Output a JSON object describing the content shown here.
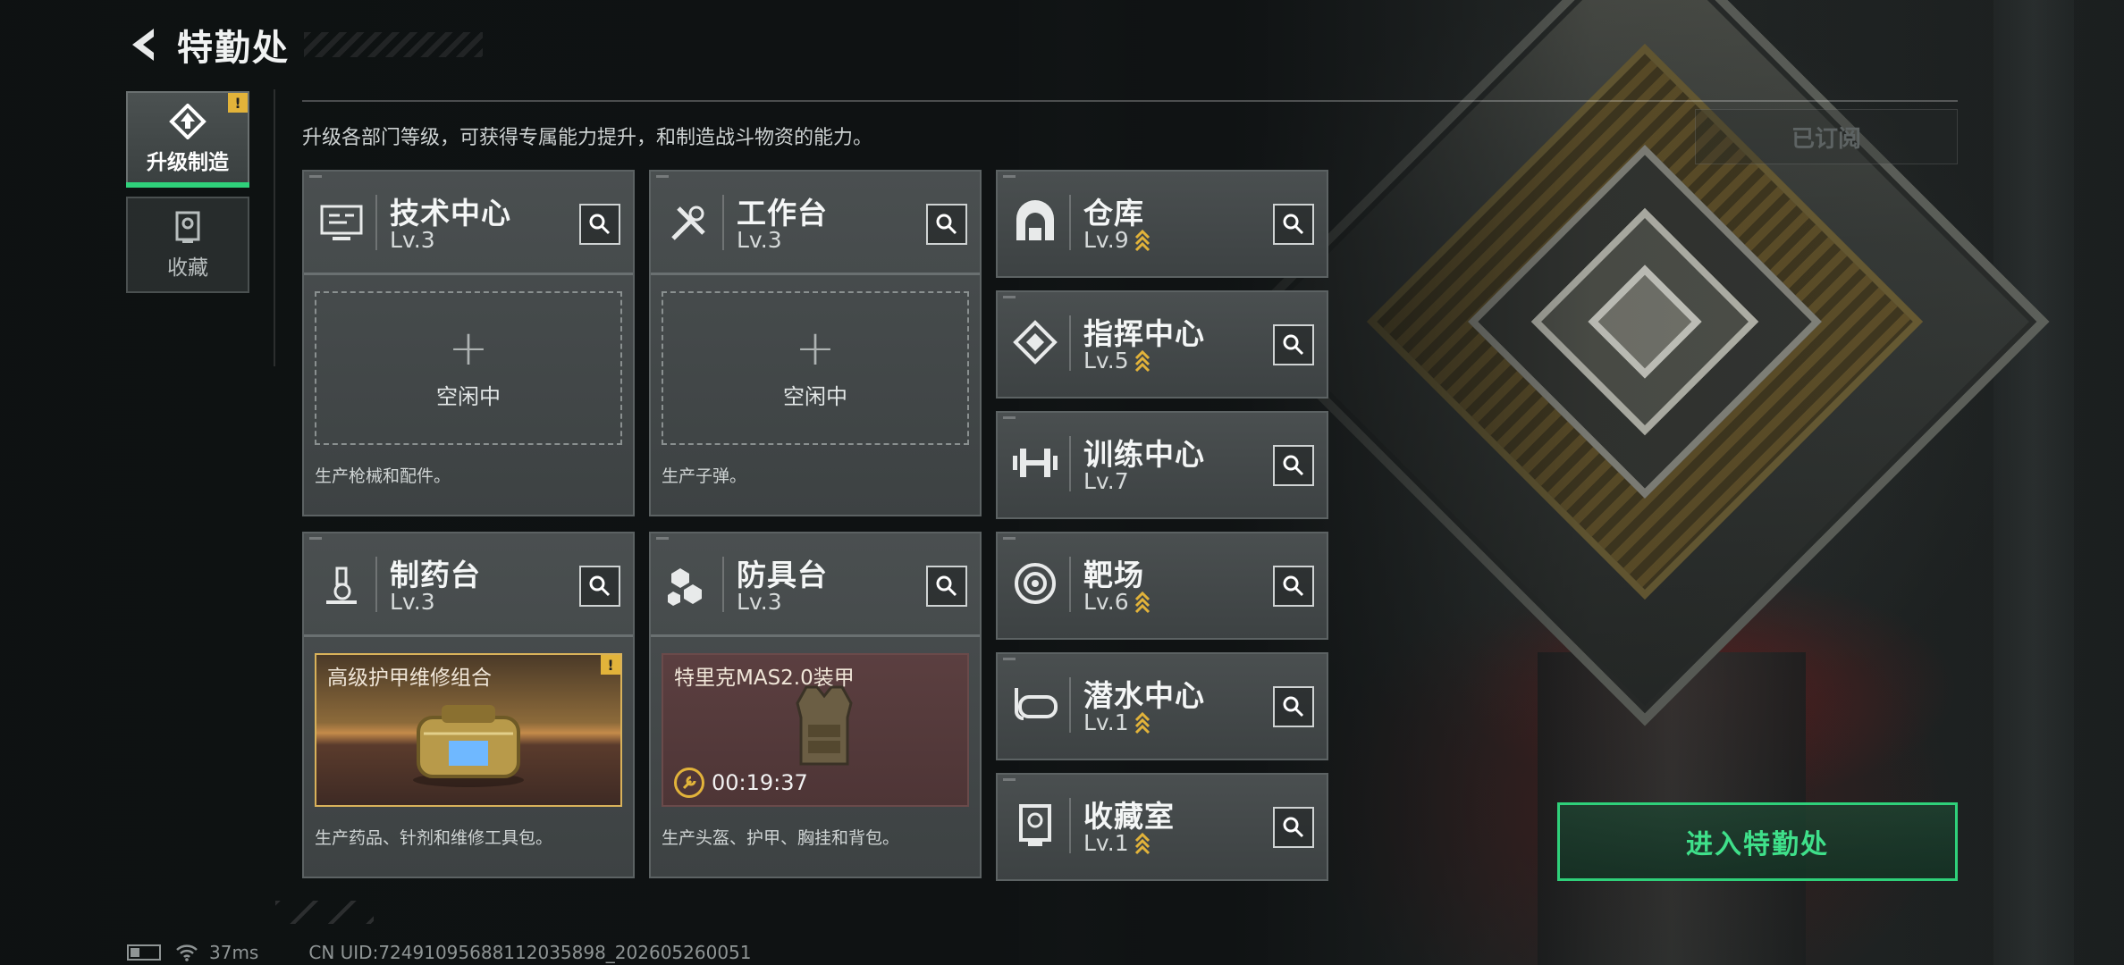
{
  "header": {
    "title": "特勤处"
  },
  "sidenav": {
    "items": [
      {
        "label": "升级制造",
        "active": true,
        "badge": "!"
      },
      {
        "label": "收藏",
        "active": false
      }
    ]
  },
  "description": "升级各部门等级，可获得专属能力提升，和制造战斗物资的能力。",
  "subscribed_label": "已订阅",
  "departments": {
    "tech": {
      "name": "技术中心",
      "level": "Lv.3",
      "slot_state": "空闲中",
      "slot_desc": "生产枪械和配件。"
    },
    "workbench": {
      "name": "工作台",
      "level": "Lv.3",
      "slot_state": "空闲中",
      "slot_desc": "生产子弹。"
    },
    "pharmacy": {
      "name": "制药台",
      "level": "Lv.3",
      "item_name": "高级护甲维修组合",
      "item_flag": "!",
      "slot_desc": "生产药品、针剂和维修工具包。"
    },
    "armor": {
      "name": "防具台",
      "level": "Lv.3",
      "item_name": "特里克MAS2.0装甲",
      "timer": "00:19:37",
      "slot_desc": "生产头盔、护甲、胸挂和背包。"
    },
    "warehouse": {
      "name": "仓库",
      "level": "Lv.9"
    },
    "command": {
      "name": "指挥中心",
      "level": "Lv.5"
    },
    "training": {
      "name": "训练中心",
      "level": "Lv.7"
    },
    "range": {
      "name": "靶场",
      "level": "Lv.6"
    },
    "diving": {
      "name": "潜水中心",
      "level": "Lv.1"
    },
    "collection": {
      "name": "收藏室",
      "level": "Lv.1"
    }
  },
  "enter_button": "进入特勤处",
  "status": {
    "ping": "37ms",
    "uid": "CN UID:72491095688112035898_202605260051"
  },
  "colors": {
    "accent_green": "#2fd07a",
    "gold": "#e2b33a"
  }
}
